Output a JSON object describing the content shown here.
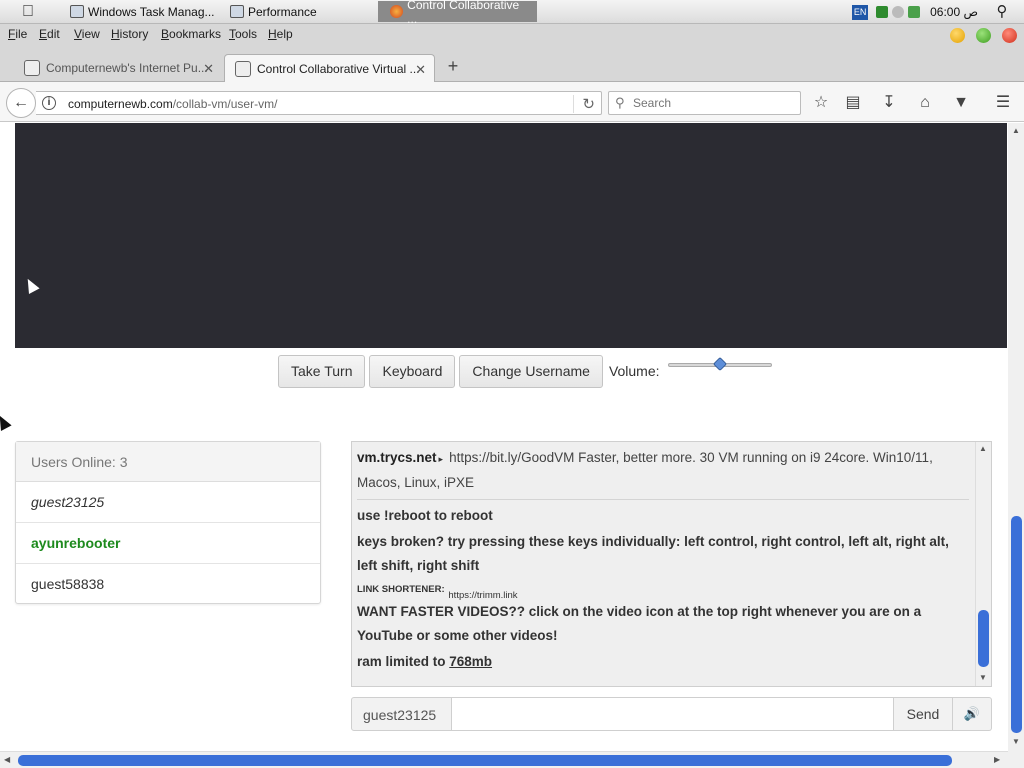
{
  "taskbar": {
    "apple_icon": "apple-icon",
    "tasks": [
      {
        "label": "Windows Task Manag...",
        "icon": "task-manager-icon"
      },
      {
        "label": "Performance",
        "icon": "performance-icon"
      },
      {
        "label": "Control Collaborative ...",
        "icon": "firefox-icon"
      }
    ],
    "lang": "EN",
    "clock": "06:00 ص"
  },
  "menubar": {
    "items": [
      "File",
      "Edit",
      "View",
      "History",
      "Bookmarks",
      "Tools",
      "Help"
    ]
  },
  "tabs": [
    {
      "label": "Computernewb's Internet Pu...",
      "active": false
    },
    {
      "label": "Control Collaborative Virtual ...",
      "active": true
    }
  ],
  "nav": {
    "url_host": "computernewb.com",
    "url_path": "/collab-vm/user-vm/",
    "search_placeholder": "Search"
  },
  "controls": {
    "take_turn": "Take Turn",
    "keyboard": "Keyboard",
    "change_username": "Change Username",
    "volume_label": "Volume:",
    "volume_level": 0.5
  },
  "users": {
    "header": "Users Online: 3",
    "list": [
      {
        "name": "guest23125",
        "type": "guest"
      },
      {
        "name": "ayunrebooter",
        "type": "admin"
      },
      {
        "name": "guest58838",
        "type": "normal"
      }
    ]
  },
  "chat": {
    "motd_nick": "vm.trycs.net",
    "motd_text": "https://bit.ly/GoodVM Faster, better more. 30 VM running on i9 24core. Win10/11, Macos, Linux, iPXE",
    "line1": "use !reboot to reboot",
    "line2": "keys broken? try pressing these keys individually: left control, right control, left alt, right alt, left shift, right shift",
    "shortener_label": "LINK SHORTENER:",
    "shortener_link": "https://trimm.link",
    "line3": "WANT FASTER VIDEOS?? click on the video icon at the top right whenever you are on a YouTube or some other videos!",
    "ram_text": "ram limited to ",
    "ram_link": "768mb"
  },
  "chat_input": {
    "username": "guest23125",
    "send": "Send",
    "mute_icon": "speaker-icon"
  },
  "colors": {
    "admin_green": "#1d8a1d",
    "scroll_blue": "#3a6fd8",
    "vm_screen": "#2b2b32"
  }
}
